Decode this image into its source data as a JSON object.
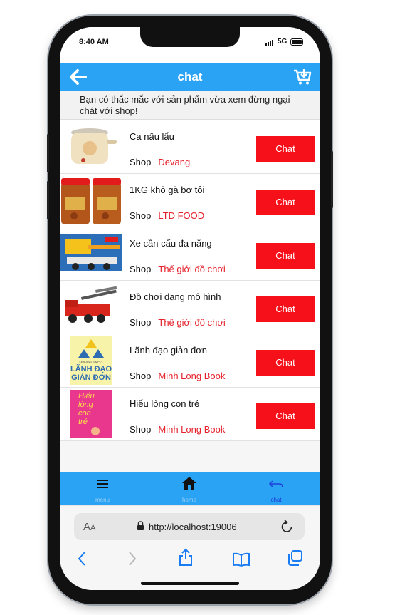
{
  "status": {
    "time": "8:40 AM",
    "network": "5G"
  },
  "header": {
    "title": "chat"
  },
  "notice": "Bạn có thắc mắc với sản phẩm vừa xem đừng ngại chát với shop!",
  "shop_prefix": "Shop",
  "chat_label": "Chat",
  "products": [
    {
      "name": "Ca nấu lẩu",
      "shop": "Devang"
    },
    {
      "name": "1KG khô gà bơ tỏi",
      "shop": "LTD FOOD"
    },
    {
      "name": "Xe cần cẩu đa năng",
      "shop": "Thế giới đồ chơi"
    },
    {
      "name": "Đồ chơi dạng mô hình",
      "shop": "Thế giới đồ chơi"
    },
    {
      "name": "Lãnh đạo giản đơn",
      "shop": "Minh Long Book"
    },
    {
      "name": "Hiểu lòng con trẻ",
      "shop": "Minh Long Book"
    }
  ],
  "book_covers": {
    "leadership": {
      "top": "LEADING SIMPLY",
      "main": "LÃNH ĐẠO",
      "sub": "GIẢN ĐƠN"
    },
    "children": {
      "line1": "Hiểu",
      "line2": "lòng",
      "line3": "con",
      "line4": "trẻ"
    }
  },
  "tabbar": {
    "menu": "menu",
    "home": "home",
    "chat": "chat"
  },
  "browser": {
    "aa": "A",
    "aa_small": "A",
    "url": "http://localhost:19006"
  },
  "colors": {
    "accent": "#2aa3f4",
    "chat_button": "#f5101a",
    "shop_name": "#e5222c"
  }
}
